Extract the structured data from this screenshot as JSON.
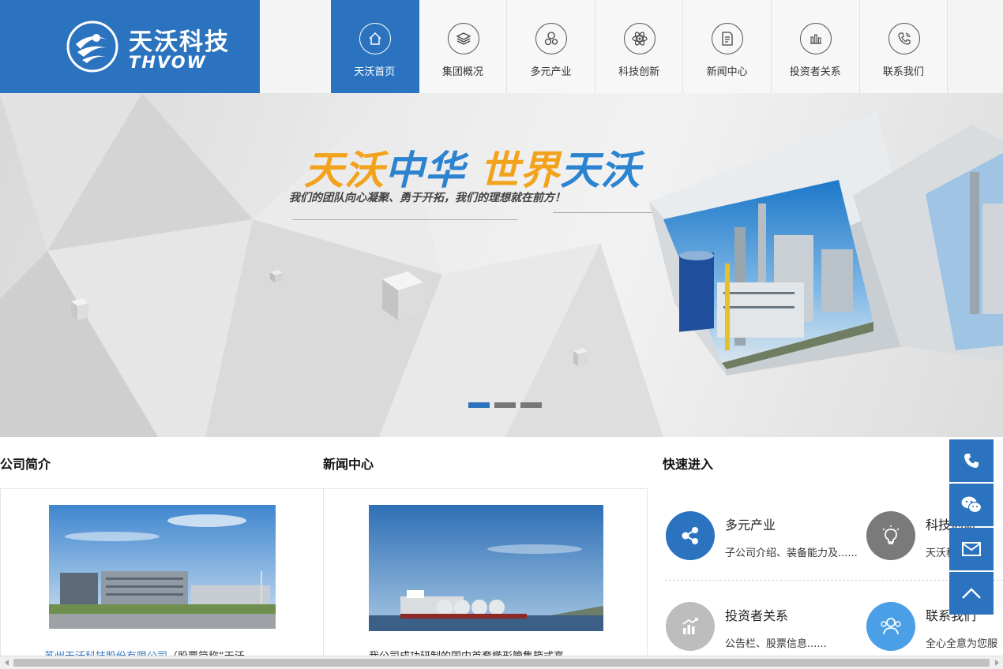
{
  "header": {
    "logo_cn": "天沃科技",
    "logo_en": "THVOW",
    "nav": [
      {
        "label": "天沃首页",
        "icon": "home-icon",
        "active": true
      },
      {
        "label": "集团概况",
        "icon": "layers-icon",
        "active": false
      },
      {
        "label": "多元产业",
        "icon": "hexagons-icon",
        "active": false
      },
      {
        "label": "科技创新",
        "icon": "atom-icon",
        "active": false
      },
      {
        "label": "新闻中心",
        "icon": "document-icon",
        "active": false
      },
      {
        "label": "投资者关系",
        "icon": "bar-chart-icon",
        "active": false
      },
      {
        "label": "联系我们",
        "icon": "phone-icon",
        "active": false
      }
    ]
  },
  "banner": {
    "slogan_part1": "天沃",
    "slogan_part2": "中华",
    "slogan_part3": "世界",
    "slogan_part4": "天沃",
    "subslogan": "我们的团队向心凝聚、勇于开拓，我们的理想就在前方！",
    "slides": 3,
    "active_slide": 1
  },
  "sections": {
    "company_title": "公司简介",
    "company_caption_link": "苏州天沃科技股份有限公司",
    "company_caption_rest": "（股票简称“天沃",
    "news_title": "新闻中心",
    "news_caption": "我公司成功研制的国内首套椭形管集箱式高",
    "quick_title": "快速进入"
  },
  "quick_access": [
    {
      "title": "多元产业",
      "desc": "子公司介绍、装备能力及......",
      "icon": "network-icon",
      "color": "#2b73bf"
    },
    {
      "title": "科技创新",
      "desc": "天沃科技坚",
      "icon": "lightbulb-icon",
      "color": "#7a7a7a"
    },
    {
      "title": "投资者关系",
      "desc": "公告栏、股票信息......",
      "icon": "growth-chart-icon",
      "color": "#bdbdbd"
    },
    {
      "title": "联系我们",
      "desc": "全心全意为您服",
      "icon": "people-icon",
      "color": "#4a9fe6"
    }
  ],
  "float_bar": [
    "phone-icon",
    "wechat-icon",
    "mail-icon",
    "arrow-up-icon"
  ],
  "colors": {
    "brand": "#2b73bf",
    "orange": "#f3a21b",
    "slogan_blue": "#2c83cf"
  }
}
